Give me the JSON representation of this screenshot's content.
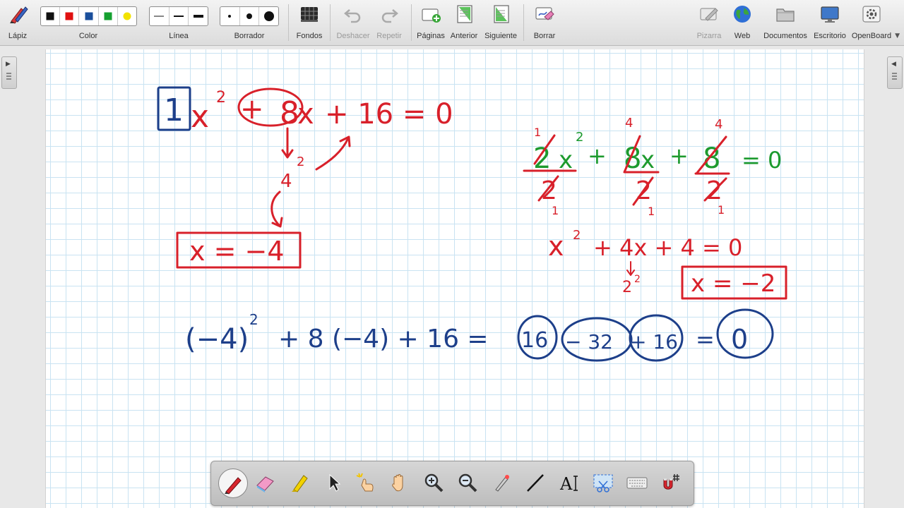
{
  "toolbar": {
    "pencil": "Lápiz",
    "color": "Color",
    "line": "Línea",
    "eraser": "Borrador",
    "backgrounds": "Fondos",
    "undo": "Deshacer",
    "redo": "Repetir",
    "pages": "Páginas",
    "previous": "Anterior",
    "next": "Siguiente",
    "clear": "Borrar",
    "board": "Pizarra",
    "web": "Web",
    "documents": "Documentos",
    "desktop": "Escritorio",
    "openboard": "OpenBoard"
  },
  "colors": {
    "palette": [
      "#111111",
      "#e01010",
      "#1b4f9c",
      "#16a030",
      "#f2e200"
    ],
    "ink_blue": "#1d3f8a",
    "ink_red": "#d8202a",
    "ink_green": "#1c9a2e",
    "grid": "#c9e3f2"
  },
  "board": {
    "eq1": {
      "coef": "1",
      "x": "x",
      "exp": "2",
      "plus": "+",
      "b": "8",
      "bx": "x",
      "rest": "+ 16 = 0",
      "arrow_sub": "2",
      "four": "4",
      "answer": "x = −4"
    },
    "eq2": {
      "top_one": "1",
      "top_four_a": "4",
      "top_four_b": "4",
      "a": "2",
      "x1": "x",
      "exp": "2",
      "plus1": "+",
      "b": "8",
      "x2": "x",
      "plus2": "+",
      "c": "8",
      "eq": "= 0",
      "den_a": "2",
      "den_b": "2",
      "den_c": "2",
      "bot_one_a": "1",
      "bot_one_b": "1",
      "bot_one_c": "1"
    },
    "eq3": {
      "x": "x",
      "exp": "2",
      "mid": "+ 4x  + 4 = 0",
      "base": "2",
      "base_exp": "2",
      "answer": "x = −2"
    },
    "check": {
      "lhs_open": "(−4)",
      "lhs_exp": "2",
      "lhs_rest": "+ 8 (−4) + 16 =",
      "t1": "16",
      "t2": "− 32",
      "t3": "+ 16",
      "eq": "=",
      "result": "0"
    }
  },
  "dock": [
    {
      "icon": "pen-icon",
      "active": true
    },
    {
      "icon": "eraser-icon"
    },
    {
      "icon": "highlighter-icon"
    },
    {
      "icon": "pointer-icon"
    },
    {
      "icon": "laser-pointer-icon"
    },
    {
      "icon": "hand-icon"
    },
    {
      "icon": "zoom-in-icon"
    },
    {
      "icon": "zoom-out-icon"
    },
    {
      "icon": "laser-pen-icon"
    },
    {
      "icon": "line-icon"
    },
    {
      "icon": "text-icon"
    },
    {
      "icon": "capture-icon"
    },
    {
      "icon": "keyboard-icon"
    },
    {
      "icon": "magnet-icon"
    }
  ]
}
